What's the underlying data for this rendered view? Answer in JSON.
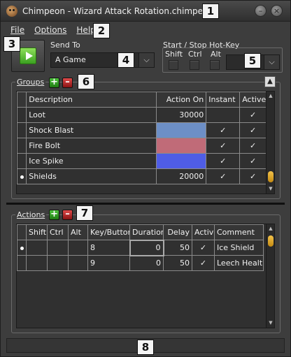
{
  "window": {
    "title": "Chimpeon - Wizard Attack Rotation.chimpeon",
    "minimize_glyph": "–",
    "close_glyph": "×"
  },
  "badges": [
    "1",
    "2",
    "3",
    "4",
    "5",
    "6",
    "7",
    "8"
  ],
  "menu": {
    "file": "File",
    "options": "Options",
    "help": "Help"
  },
  "send_to": {
    "label": "Send To",
    "value": "A Game"
  },
  "hotkey": {
    "label": "Start / Stop Hot-Key",
    "shift": "Shift",
    "ctrl": "Ctrl",
    "alt": "Alt",
    "key": ""
  },
  "groups": {
    "label": "Groups",
    "columns": [
      "",
      "Description",
      "Action On",
      "Instant",
      "Active"
    ],
    "rows": [
      {
        "selected": false,
        "description": "Loot",
        "action_on": "30000",
        "color": "",
        "instant": "",
        "active": "✓"
      },
      {
        "selected": false,
        "description": "Shock Blast",
        "action_on": "",
        "color": "#6d8fc6",
        "instant": "✓",
        "active": "✓"
      },
      {
        "selected": false,
        "description": "Fire Bolt",
        "action_on": "",
        "color": "#c06b78",
        "instant": "✓",
        "active": "✓"
      },
      {
        "selected": false,
        "description": "Ice Spike",
        "action_on": "",
        "color": "#4f5de6",
        "instant": "✓",
        "active": "✓"
      },
      {
        "selected": true,
        "description": "Shields",
        "action_on": "20000",
        "color": "",
        "instant": "✓",
        "active": "✓"
      }
    ]
  },
  "actions": {
    "label": "Actions",
    "columns": [
      "",
      "Shift",
      "Ctrl",
      "Alt",
      "Key/Button",
      "Duration",
      "Delay",
      "Active",
      "Comment"
    ],
    "rows": [
      {
        "selected": true,
        "shift": "",
        "ctrl": "",
        "alt": "",
        "key": "8",
        "duration": "0",
        "delay": "50",
        "active": "✓",
        "comment": "Ice Shield"
      },
      {
        "selected": false,
        "shift": "",
        "ctrl": "",
        "alt": "",
        "key": "9",
        "duration": "0",
        "delay": "50",
        "active": "✓",
        "comment": "Leech Healt"
      }
    ]
  },
  "icons": {
    "app": "chimp-face-icon",
    "play": "play-icon",
    "add": "plus-icon",
    "remove": "minus-icon",
    "up": "arrow-up-icon",
    "dropdown": "chevron-down-icon"
  },
  "colors": {
    "play_green": "#4fc02a",
    "add_green": "#2ea01e",
    "remove_red": "#c82a2a",
    "scroll_thumb": "#e5a82a"
  }
}
